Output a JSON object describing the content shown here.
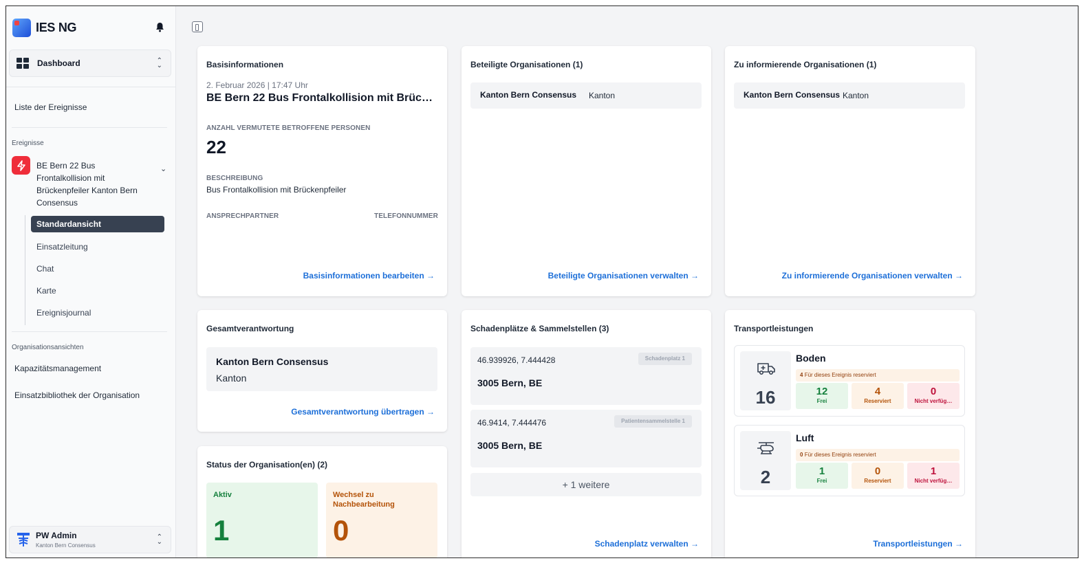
{
  "app": {
    "name": "IES NG"
  },
  "sidebar": {
    "switcher_label": "Dashboard",
    "list_link": "Liste der Ereignisse",
    "events_section": "Ereignisse",
    "event_name": "BE Bern 22 Bus Frontalkollision mit Brückenpfeiler Kanton Bern Consensus",
    "sub_items": [
      "Standardansicht",
      "Einsatzleitung",
      "Chat",
      "Karte",
      "Ereignisjournal"
    ],
    "org_section": "Organisationsansichten",
    "org_links": [
      "Kapazitätsmanagement",
      "Einsatzbibliothek der Organisation"
    ],
    "user": {
      "name": "PW Admin",
      "org": "Kanton Bern Consensus"
    }
  },
  "basis": {
    "title": "Basisinformationen",
    "date": "2. Februar 2026 | 17:47 Uhr",
    "event_title": "BE Bern 22 Bus Frontalkollision mit Brücke…",
    "count_label": "ANZAHL VERMUTETE BETROFFENE PERSONEN",
    "count": "22",
    "desc_label": "BESCHREIBUNG",
    "desc": "Bus Frontalkollision mit Brückenpfeiler",
    "contact_label": "ANSPRECHPARTNER",
    "phone_label": "TELEFONNUMMER",
    "link": "Basisinformationen bearbeiten →"
  },
  "beteiligte": {
    "title": "Beteiligte Organisationen (1)",
    "org_name": "Kanton Bern Consensus",
    "org_type": "Kanton",
    "link": "Beteiligte Organisationen verwalten →"
  },
  "informierende": {
    "title": "Zu informierende Organisationen (1)",
    "org_name": "Kanton Bern Consensus",
    "org_type": "Kanton",
    "link": "Zu informierende Organisationen verwalten →"
  },
  "gesamt": {
    "title": "Gesamtverantwortung",
    "org_name": "Kanton Bern Consensus",
    "org_type": "Kanton",
    "link": "Gesamtverantwortung übertragen →"
  },
  "status": {
    "title": "Status der Organisation(en) (2)",
    "active_label": "Aktiv",
    "active_count": "1",
    "switch_label": "Wechsel zu Nachbearbeitung",
    "switch_count": "0"
  },
  "sites": {
    "title": "Schadenplätze & Sammelstellen (3)",
    "items": [
      {
        "coords": "46.939926, 7.444428",
        "address": "3005 Bern, BE",
        "badge": "Schadenplatz 1"
      },
      {
        "coords": "46.9414, 7.444476",
        "address": "3005 Bern, BE",
        "badge": "Patientensammelstelle 1"
      }
    ],
    "more": "+ 1 weitere",
    "link": "Schadenplatz verwalten →"
  },
  "transport": {
    "title": "Transportleistungen",
    "items": [
      {
        "name": "Boden",
        "total": "16",
        "reserved_count": "4",
        "reserved_text": "Für dieses Ereignis reserviert",
        "free": "12",
        "free_label": "Frei",
        "res": "4",
        "res_label": "Reserviert",
        "na": "0",
        "na_label": "Nicht verfüg…",
        "icon": "ambulance-icon"
      },
      {
        "name": "Luft",
        "total": "2",
        "reserved_count": "0",
        "reserved_text": "Für dieses Ereignis reserviert",
        "free": "1",
        "free_label": "Frei",
        "res": "0",
        "res_label": "Reserviert",
        "na": "1",
        "na_label": "Nicht verfüg…",
        "icon": "helicopter-icon"
      }
    ],
    "link": "Transportleistungen →"
  }
}
